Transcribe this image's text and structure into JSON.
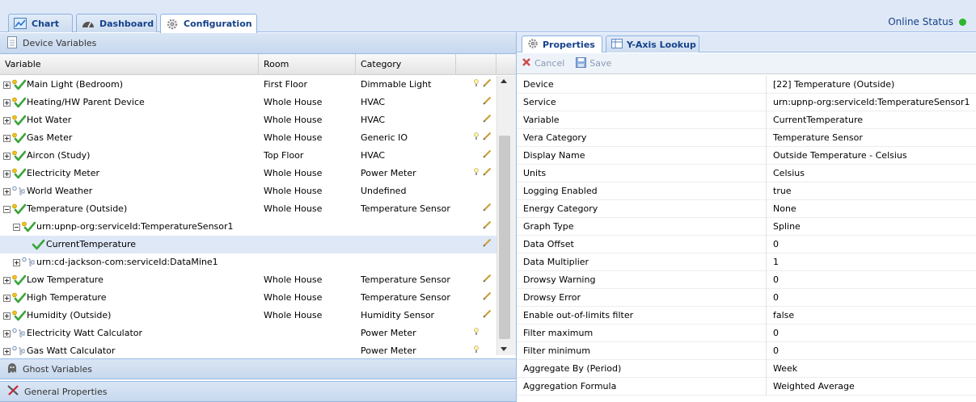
{
  "tabs": [
    {
      "label": "Chart",
      "icon": "chart-icon"
    },
    {
      "label": "Dashboard",
      "icon": "dashboard-icon"
    },
    {
      "label": "Configuration",
      "icon": "gear-icon"
    }
  ],
  "online_status": {
    "label": "Online Status",
    "color": "#2db52d"
  },
  "left_panel": {
    "title": "Device Variables",
    "columns": [
      "Variable",
      "Room",
      "Category"
    ],
    "rows": [
      {
        "name": "Main Light (Bedroom)",
        "room": "First Floor",
        "category": "Dimmable Light",
        "level": 0,
        "expand": "plus",
        "status": "green",
        "bulb": true,
        "edit": true
      },
      {
        "name": "Heating/HW Parent Device",
        "room": "Whole House",
        "category": "HVAC",
        "level": 0,
        "expand": "plus",
        "status": "green",
        "bulb": false,
        "edit": true
      },
      {
        "name": "Hot Water",
        "room": "Whole House",
        "category": "HVAC",
        "level": 0,
        "expand": "plus",
        "status": "green",
        "bulb": false,
        "edit": true
      },
      {
        "name": "Gas Meter",
        "room": "Whole House",
        "category": "Generic IO",
        "level": 0,
        "expand": "plus",
        "status": "green",
        "bulb": true,
        "edit": true
      },
      {
        "name": "Aircon (Study)",
        "room": "Top Floor",
        "category": "HVAC",
        "level": 0,
        "expand": "plus",
        "status": "green",
        "bulb": false,
        "edit": true
      },
      {
        "name": "Electricity Meter",
        "room": "Whole House",
        "category": "Power Meter",
        "level": 0,
        "expand": "plus",
        "status": "green",
        "bulb": true,
        "edit": true
      },
      {
        "name": "World Weather",
        "room": "Whole House",
        "category": "Undefined",
        "level": 0,
        "expand": "plus",
        "status": "grey",
        "bulb": false,
        "edit": false
      },
      {
        "name": "Temperature (Outside)",
        "room": "Whole House",
        "category": "Temperature Sensor",
        "level": 0,
        "expand": "minus",
        "status": "green",
        "bulb": false,
        "edit": true
      },
      {
        "name": "urn:upnp-org:serviceId:TemperatureSensor1",
        "room": "",
        "category": "",
        "level": 1,
        "expand": "minus",
        "status": "green",
        "bulb": false,
        "edit": true
      },
      {
        "name": "CurrentTemperature",
        "room": "",
        "category": "",
        "level": 2,
        "expand": "none",
        "status": "check",
        "bulb": false,
        "edit": true,
        "selected": true
      },
      {
        "name": "urn:cd-jackson-com:serviceId:DataMine1",
        "room": "",
        "category": "",
        "level": 1,
        "expand": "plus",
        "status": "grey",
        "bulb": false,
        "edit": false
      },
      {
        "name": "Low Temperature",
        "room": "Whole House",
        "category": "Temperature Sensor",
        "level": 0,
        "expand": "plus",
        "status": "green",
        "bulb": false,
        "edit": true
      },
      {
        "name": "High Temperature",
        "room": "Whole House",
        "category": "Temperature Sensor",
        "level": 0,
        "expand": "plus",
        "status": "green",
        "bulb": false,
        "edit": true
      },
      {
        "name": "Humidity (Outside)",
        "room": "Whole House",
        "category": "Humidity Sensor",
        "level": 0,
        "expand": "plus",
        "status": "green",
        "bulb": false,
        "edit": true
      },
      {
        "name": "Electricity Watt Calculator",
        "room": "",
        "category": "Power Meter",
        "level": 0,
        "expand": "plus",
        "status": "grey",
        "bulb": true,
        "edit": false
      },
      {
        "name": "Gas Watt Calculator",
        "room": "",
        "category": "Power Meter",
        "level": 0,
        "expand": "plus",
        "status": "grey",
        "bulb": true,
        "edit": false
      }
    ]
  },
  "ghost_panel": {
    "title": "Ghost Variables"
  },
  "general_panel": {
    "title": "General Properties"
  },
  "right_panel": {
    "tabs": [
      {
        "label": "Properties"
      },
      {
        "label": "Y-Axis Lookup"
      }
    ],
    "toolbar": {
      "cancel": "Cancel",
      "save": "Save"
    },
    "properties": [
      {
        "key": "Device",
        "value": "[22] Temperature (Outside)"
      },
      {
        "key": "Service",
        "value": "urn:upnp-org:serviceId:TemperatureSensor1"
      },
      {
        "key": "Variable",
        "value": "CurrentTemperature"
      },
      {
        "key": "Vera Category",
        "value": "Temperature Sensor"
      },
      {
        "key": "Display Name",
        "value": "Outside Temperature - Celsius"
      },
      {
        "key": "Units",
        "value": "Celsius"
      },
      {
        "key": "Logging Enabled",
        "value": "true"
      },
      {
        "key": "Energy Category",
        "value": "None"
      },
      {
        "key": "Graph Type",
        "value": "Spline"
      },
      {
        "key": "Data Offset",
        "value": "0"
      },
      {
        "key": "Data Multiplier",
        "value": "1"
      },
      {
        "key": "Drowsy Warning",
        "value": "0"
      },
      {
        "key": "Drowsy Error",
        "value": "0"
      },
      {
        "key": "Enable out-of-limits filter",
        "value": "false"
      },
      {
        "key": "Filter maximum",
        "value": "0"
      },
      {
        "key": "Filter minimum",
        "value": "0"
      },
      {
        "key": "Aggregate By (Period)",
        "value": "Week"
      },
      {
        "key": "Aggregation Formula",
        "value": "Weighted Average"
      }
    ]
  }
}
